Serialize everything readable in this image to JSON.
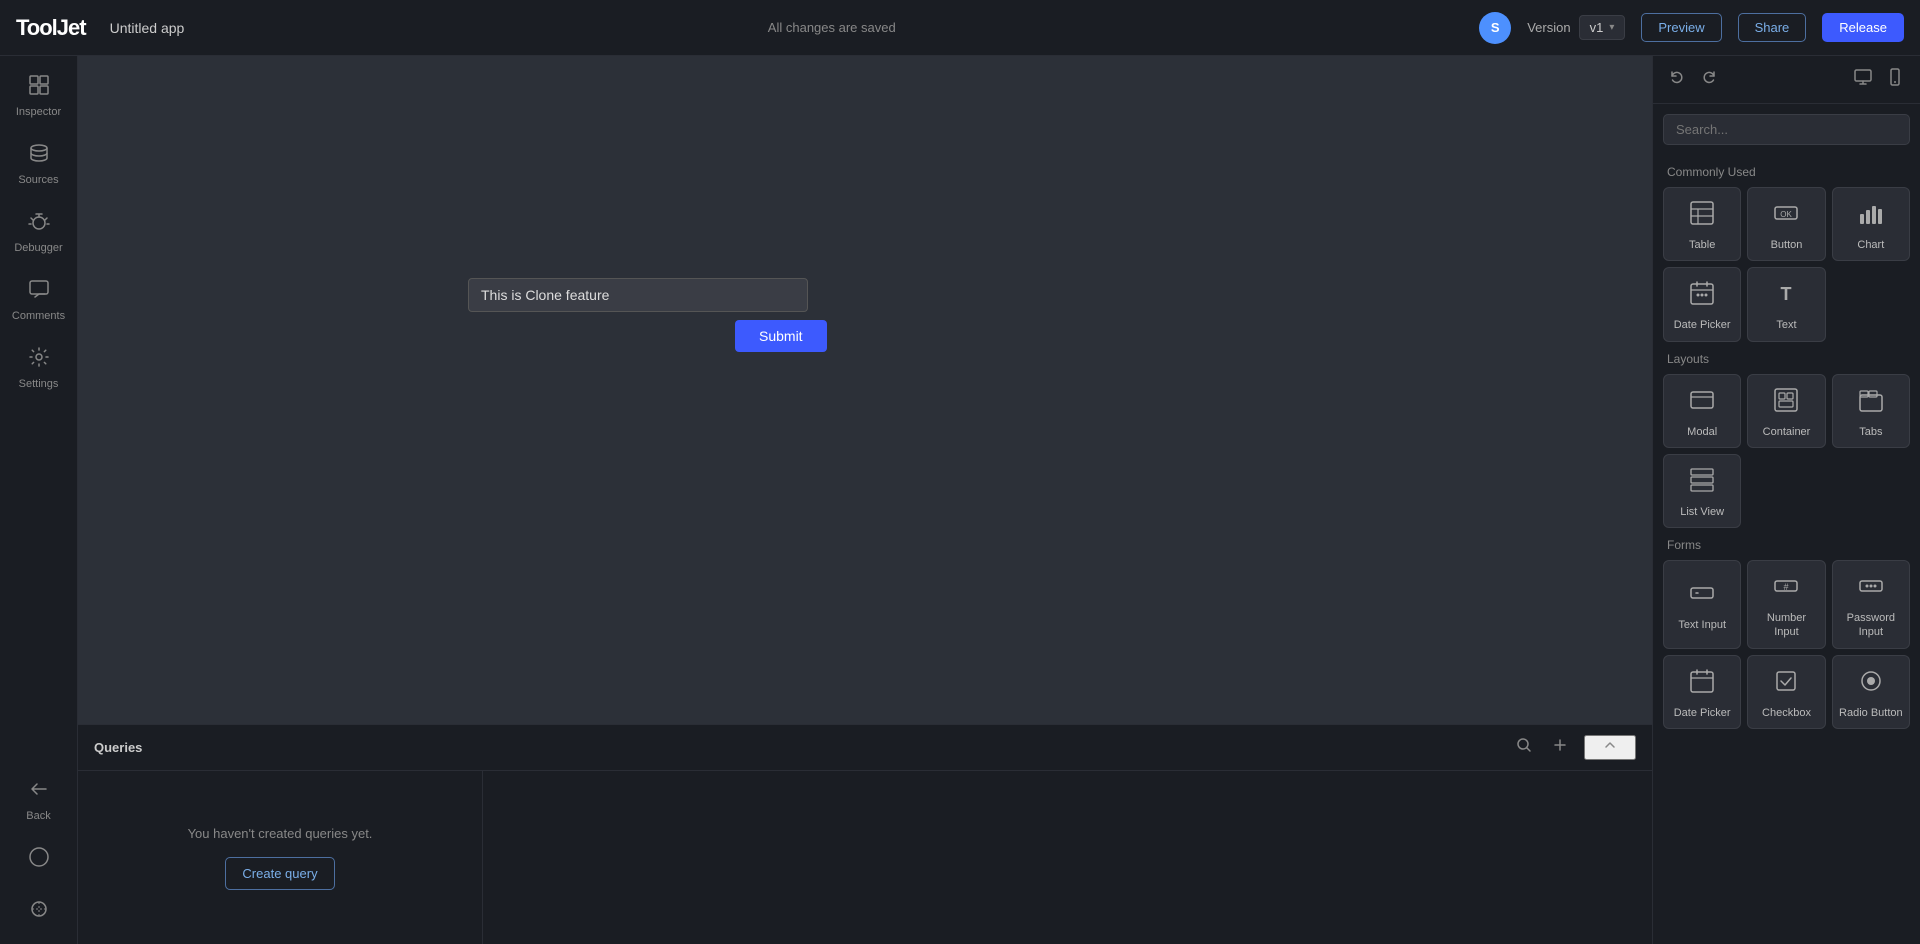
{
  "topbar": {
    "logo_tj": "Tool",
    "logo_jet": "Jet",
    "app_title": "Untitled app",
    "save_status": "All changes are saved",
    "avatar_initial": "S",
    "version_label": "Version",
    "version_value": "v1",
    "btn_preview": "Preview",
    "btn_share": "Share",
    "btn_release": "Release"
  },
  "sidebar": {
    "items": [
      {
        "id": "inspector",
        "icon": "⊡",
        "label": "Inspector"
      },
      {
        "id": "sources",
        "icon": "🗄",
        "label": "Sources"
      },
      {
        "id": "debugger",
        "icon": "🐞",
        "label": "Debugger"
      },
      {
        "id": "comments",
        "icon": "💬",
        "label": "Comments"
      },
      {
        "id": "settings",
        "icon": "⚙",
        "label": "Settings"
      }
    ],
    "bottom_items": [
      {
        "id": "back",
        "icon": "↩",
        "label": "Back"
      },
      {
        "id": "chat",
        "icon": "◯",
        "label": ""
      },
      {
        "id": "theme",
        "icon": "✺",
        "label": ""
      }
    ]
  },
  "canvas": {
    "widget_text": "This is Clone feature",
    "submit_label": "Submit"
  },
  "queries": {
    "title": "Queries",
    "empty_text": "You haven't created queries yet.",
    "create_btn": "Create query"
  },
  "right_panel": {
    "search_placeholder": "Search...",
    "sections": {
      "commonly_used": {
        "label": "Commonly Used",
        "items": [
          {
            "id": "table",
            "icon": "⊞",
            "label": "Table"
          },
          {
            "id": "button",
            "icon": "⊡",
            "label": "Button"
          },
          {
            "id": "chart",
            "icon": "📊",
            "label": "Chart"
          },
          {
            "id": "date-picker",
            "icon": "📅",
            "label": "Date Picker"
          },
          {
            "id": "text",
            "icon": "T",
            "label": "Text"
          }
        ]
      },
      "layouts": {
        "label": "Layouts",
        "items": [
          {
            "id": "modal",
            "icon": "▭",
            "label": "Modal"
          },
          {
            "id": "container",
            "icon": "⊞",
            "label": "Container"
          },
          {
            "id": "tabs",
            "icon": "⊟",
            "label": "Tabs"
          },
          {
            "id": "listview",
            "icon": "☰",
            "label": "List View"
          }
        ]
      },
      "forms": {
        "label": "Forms",
        "items": [
          {
            "id": "text-input",
            "icon": "▭",
            "label": "Text Input"
          },
          {
            "id": "number-input",
            "icon": "#",
            "label": "Number Input"
          },
          {
            "id": "password-input",
            "icon": "🔒",
            "label": "Password Input"
          },
          {
            "id": "date-picker2",
            "icon": "📅",
            "label": "Date Picker"
          },
          {
            "id": "checkbox",
            "icon": "☑",
            "label": "Checkbox"
          },
          {
            "id": "radio-button",
            "icon": "⊙",
            "label": "Radio Button"
          }
        ]
      }
    }
  }
}
